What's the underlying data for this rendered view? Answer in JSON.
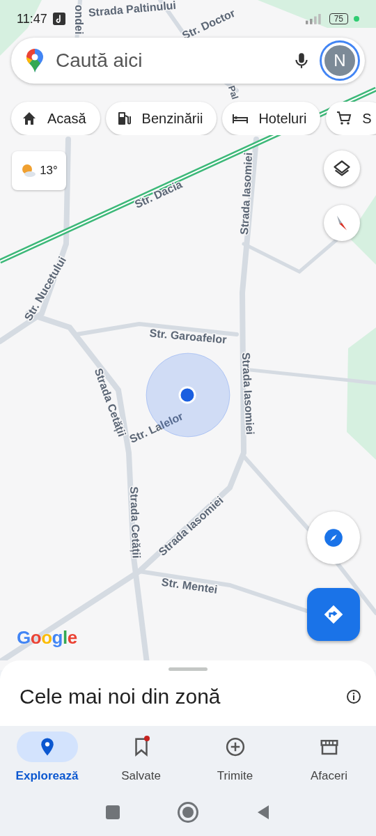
{
  "status_bar": {
    "time": "11:47",
    "battery": "75"
  },
  "search": {
    "placeholder": "Caută aici",
    "avatar_letter": "N"
  },
  "chips": [
    {
      "label": "Acasă"
    },
    {
      "label": "Benzinării"
    },
    {
      "label": "Hoteluri"
    },
    {
      "label": "S"
    }
  ],
  "weather": {
    "temperature": "13°"
  },
  "map": {
    "labels": [
      {
        "text": "Strada Paltinului"
      },
      {
        "text": "ondei"
      },
      {
        "text": "Str. Doctor"
      },
      {
        "text": "Pal"
      },
      {
        "text": "Str. Dacia"
      },
      {
        "text": "Strada Iasomiei"
      },
      {
        "text": "Str. Nucetului"
      },
      {
        "text": "Str. Garoafelor"
      },
      {
        "text": "Strada Iasomiei"
      },
      {
        "text": "Strada Cetății"
      },
      {
        "text": "Str. Lalelor"
      },
      {
        "text": "Strada Cetății"
      },
      {
        "text": "Strada Iasomiei"
      },
      {
        "text": "Str. Mentei"
      }
    ],
    "logo": "Google"
  },
  "sheet": {
    "title": "Cele mai noi din zonă"
  },
  "nav": [
    {
      "label": "Explorează",
      "selected": true,
      "badge": false
    },
    {
      "label": "Salvate",
      "selected": false,
      "badge": true
    },
    {
      "label": "Trimite",
      "selected": false,
      "badge": false
    },
    {
      "label": "Afaceri",
      "selected": false,
      "badge": false
    }
  ]
}
